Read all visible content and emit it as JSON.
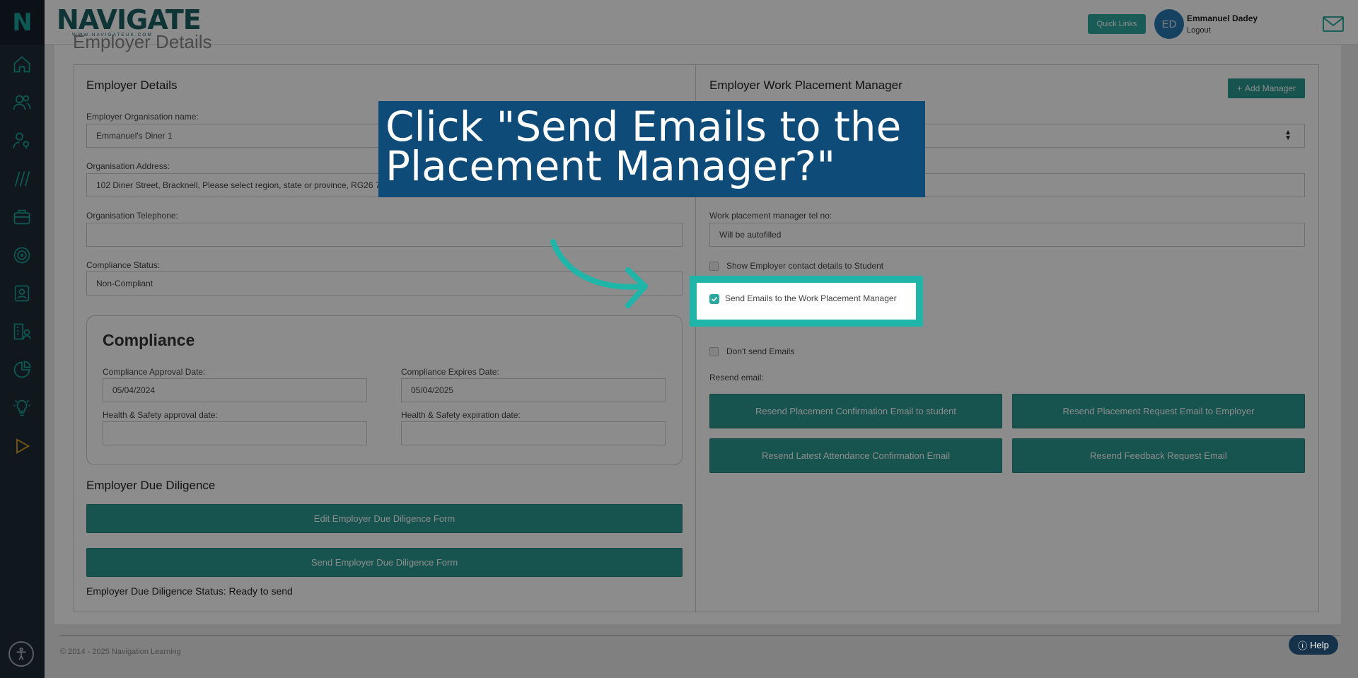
{
  "sidebar": {
    "logo": "N",
    "icons": [
      "home-icon",
      "users-icon",
      "user-pin-icon",
      "courses-icon",
      "briefcase-icon",
      "target-icon",
      "contact-card-icon",
      "organisation-icon",
      "pie-chart-icon",
      "lightbulb-icon",
      "play-icon"
    ]
  },
  "header": {
    "brand": "NAVIGATE",
    "brand_sub": "WWW.NAVIGATEUK.COM",
    "quick_links": "Quick Links",
    "avatar": "ED",
    "user_name": "Emmanuel Dadey",
    "logout": "Logout"
  },
  "page": {
    "heading": "Employer Details"
  },
  "employer": {
    "title": "Employer Details",
    "org_name_label": "Employer Organisation name:",
    "org_name_value": "Emmanuel's Diner 1",
    "address_label": "Organisation Address:",
    "address_value": "102 Diner Street, Bracknell, Please select region, state or province, RG26 7DL",
    "telephone_label": "Organisation Telephone:",
    "telephone_value": "",
    "compliance_status_label": "Compliance Status:",
    "compliance_status_value": "Non-Compliant"
  },
  "compliance": {
    "title": "Compliance",
    "approval_label": "Compliance Approval Date:",
    "approval_value": "05/04/2024",
    "expires_label": "Compliance Expires Date:",
    "expires_value": "05/04/2025",
    "hs_approval_label": "Health & Safety approval date:",
    "hs_approval_value": "",
    "hs_expiry_label": "Health & Safety expiration date:",
    "hs_expiry_value": ""
  },
  "due_diligence": {
    "title": "Employer Due Diligence",
    "edit_button": "Edit Employer Due Diligence Form",
    "send_button": "Send Employer Due Diligence Form",
    "status": "Employer Due Diligence Status: Ready to send"
  },
  "manager": {
    "title": "Employer Work Placement Manager",
    "add_button": "Add Manager",
    "tel_label": "Work placement manager tel no:",
    "tel_value": "Will be autofilled",
    "show_contact": "Show Employer contact details to Student",
    "send_emails_manager": "Send Emails to the Work Placement Manager",
    "dont_send": "Don't send Emails",
    "resend_label": "Resend email:",
    "resend_buttons": [
      "Resend Placement Confirmation Email to student",
      "Resend Placement Request Email to Employer",
      "Resend Latest Attendance Confirmation Email",
      "Resend Feedback Request Email"
    ]
  },
  "footer": {
    "copyright": "© 2014 - 2025 Navigation Learning",
    "help": "Help"
  },
  "callout": {
    "text": "Click \"Send Emails to the Placement Manager?\""
  },
  "colors": {
    "teal": "#2a9a91",
    "highlight": "#1fb5a8",
    "callout_bg": "#0e4b78",
    "sidebar_bg": "#1e2a36"
  }
}
